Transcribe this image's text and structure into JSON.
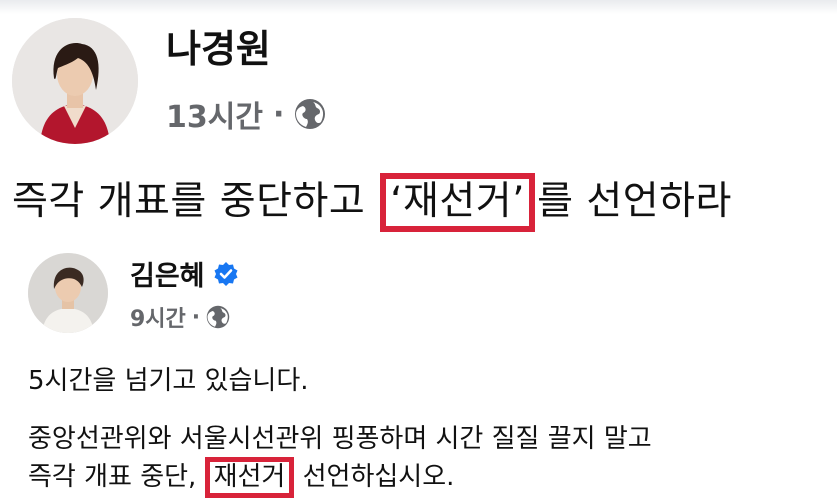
{
  "post": {
    "author": "나경원",
    "time": "13시간",
    "separator": "·",
    "audience_icon": "globe-icon",
    "headline_before": "즉각 개표를 중단하고 ",
    "headline_highlight": "‘재선거’",
    "headline_after": "를 선언하라"
  },
  "shared_post": {
    "author": "김은혜",
    "verified_icon": "verified-badge-icon",
    "time": "9시간",
    "separator": "·",
    "audience_icon": "globe-icon",
    "line1": "5시간을 넘기고 있습니다.",
    "line2": "중앙선관위와 서울시선관위 핑퐁하며 시간 질질 끌지 말고",
    "line3_before": "즉각 개표 중단, ",
    "line3_highlight": "재선거",
    "line3_after": " 선언하십시오."
  },
  "colors": {
    "highlight_box": "#d8233a",
    "meta_text": "#65676b",
    "verified_blue": "#1877f2"
  }
}
